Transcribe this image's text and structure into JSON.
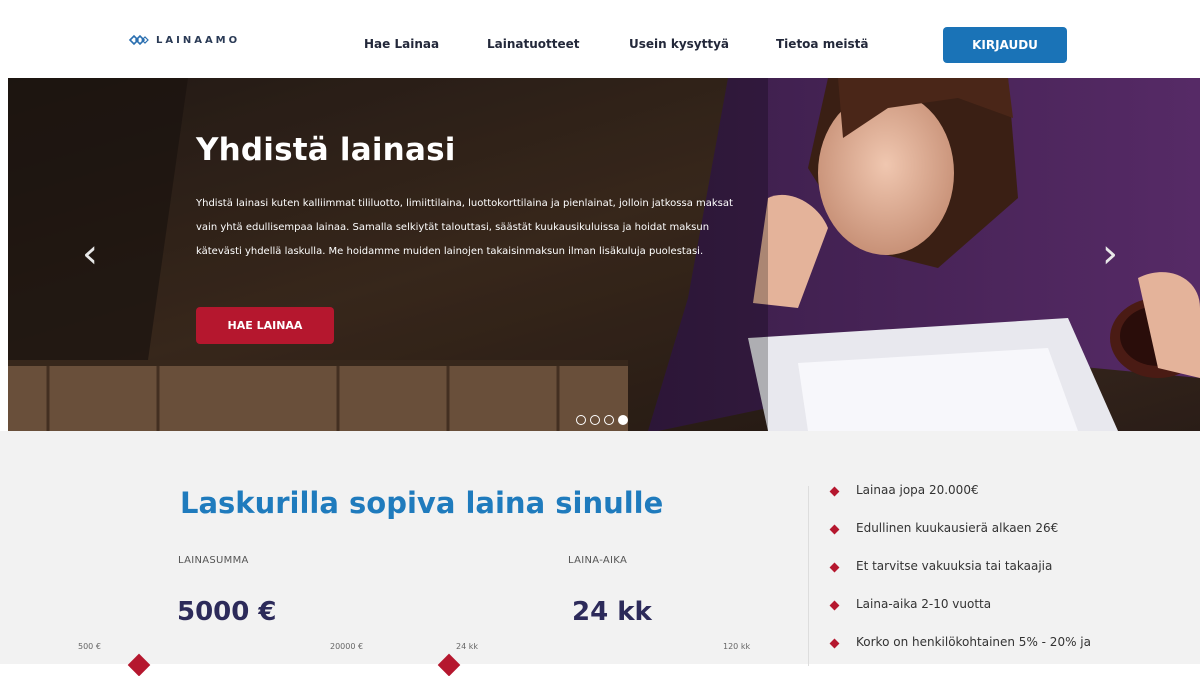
{
  "header": {
    "logo_text": "LAINAAMO",
    "nav": [
      "Hae Lainaa",
      "Lainatuotteet",
      "Usein kysyttyä",
      "Tietoa meistä"
    ],
    "login_label": "KIRJAUDU"
  },
  "hero": {
    "title": "Yhdistä lainasi",
    "text": "Yhdistä lainasi kuten kalliimmat tililuotto, limiittilaina, luottokorttilaina ja pienlainat, jolloin jatkossa maksat vain yhtä edullisempaa lainaa. Samalla selkiytät talouttasi, säästät kuukausikuluissa ja hoidat maksun kätevästi yhdellä laskulla. Me hoidamme muiden lainojen takaisinmaksun ilman lisäkuluja puolestasi.",
    "cta_label": "HAE LAINAA",
    "prev_icon": "‹",
    "next_icon": "›",
    "slides": 4,
    "active_slide": 4
  },
  "calculator": {
    "title": "Laskurilla sopiva laina sinulle",
    "amount": {
      "label": "LAINASUMMA",
      "value": "5000 €",
      "min": "500 €",
      "max": "20000 €"
    },
    "term": {
      "label": "LAINA-AIKA",
      "value": "24 kk",
      "min": "24 kk",
      "max": "120 kk"
    }
  },
  "features": [
    "Lainaa jopa 20.000€",
    "Edullinen kuukausierä alkaen 26€",
    "Et tarvitse vakuuksia tai takaajia",
    "Laina-aika 2-10 vuotta",
    "Korko on henkilökohtainen 5% - 20% ja"
  ],
  "colors": {
    "brand_blue": "#1a73b7",
    "accent_red": "#b5172e",
    "title_blue": "#1f7bbd",
    "value_navy": "#2c2a5a"
  }
}
